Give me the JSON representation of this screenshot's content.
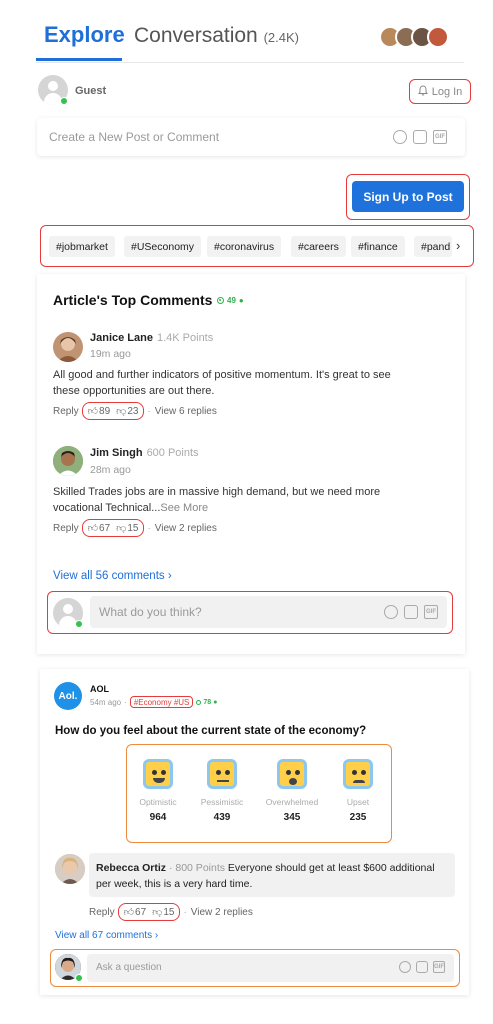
{
  "header": {
    "tab_explore": "Explore",
    "tab_conversation": "Conversation",
    "conversation_count": "(2.4K)"
  },
  "guest": {
    "name": "Guest",
    "login_label": "Log In"
  },
  "new_post": {
    "placeholder": "Create a New Post or Comment",
    "gif_label": "GIF"
  },
  "signup": {
    "label": "Sign Up to Post"
  },
  "tags": [
    "#jobmarket",
    "#USeconomy",
    "#coronavirus",
    "#careers",
    "#finance",
    "#pand"
  ],
  "top_comments": {
    "title": "Article's Top Comments",
    "live_count": "49",
    "comments": [
      {
        "name": "Janice Lane",
        "points": "1.4K Points",
        "time": "19m ago",
        "text": "All good and further indicators of positive momentum. It's great to see these opportunities are out there.",
        "reply": "Reply",
        "up": "89",
        "down": "23",
        "view_replies": "View 6 replies"
      },
      {
        "name": "Jim Singh",
        "points": "600 Points",
        "time": "28m ago",
        "text": "Skilled Trades jobs are in massive high demand, but we need more vocational Technical...",
        "see_more": "See More",
        "reply": "Reply",
        "up": "67",
        "down": "15",
        "view_replies": "View 2 replies"
      }
    ],
    "view_all": "View all 56 comments",
    "reply_placeholder": "What do you think?"
  },
  "aol_post": {
    "logo": "Aol.",
    "name": "AOL",
    "time": "54m ago",
    "tags": "#Economy  #US",
    "live_count": "78",
    "question": "How do you feel about the current state of the economy?",
    "poll": [
      {
        "label": "Optimistic",
        "value": "964"
      },
      {
        "label": "Pessimistic",
        "value": "439"
      },
      {
        "label": "Overwhelmed",
        "value": "345"
      },
      {
        "label": "Upset",
        "value": "235"
      }
    ],
    "comment": {
      "name": "Rebecca Ortiz",
      "points": "800 Points",
      "text": "Everyone should get at least $600 additional per week, this is a very hard time.",
      "reply": "Reply",
      "up": "67",
      "down": "15",
      "view_replies": "View 2 replies"
    },
    "view_all": "View all 67 comments",
    "ask_placeholder": "Ask a question"
  },
  "colors": {
    "accent": "#1f6fd8",
    "highlight": "#e53b3b",
    "online": "#33c24d",
    "poll_highlight": "#f08a3c"
  }
}
